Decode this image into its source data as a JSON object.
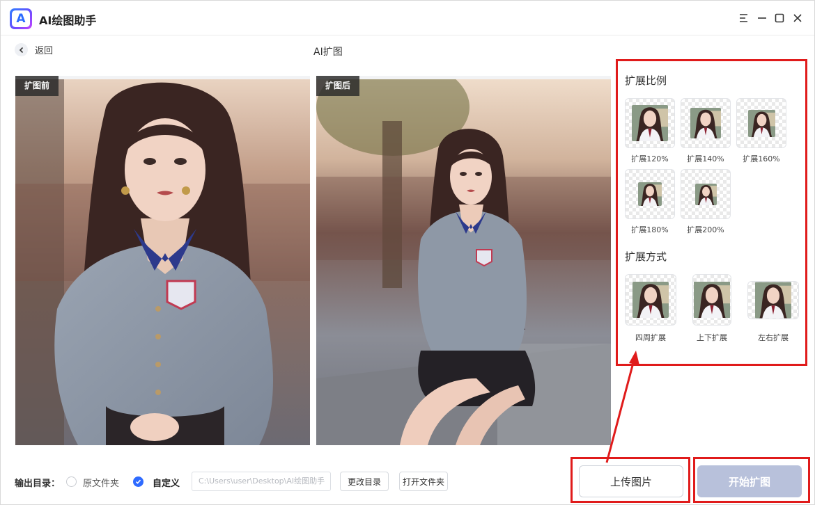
{
  "app": {
    "title": "AI绘图助手",
    "logo_letter": "A"
  },
  "window_controls": [
    "menu-icon",
    "minimize-icon",
    "maximize-icon",
    "close-icon"
  ],
  "nav": {
    "back_label": "返回",
    "page_title": "AI扩图"
  },
  "panels": {
    "before_tag": "扩图前",
    "after_tag": "扩图后"
  },
  "options": {
    "ratio_title": "扩展比例",
    "ratios": [
      {
        "label": "扩展120%",
        "scale": 1.2
      },
      {
        "label": "扩展140%",
        "scale": 1.4
      },
      {
        "label": "扩展160%",
        "scale": 1.6
      },
      {
        "label": "扩展180%",
        "scale": 1.8
      },
      {
        "label": "扩展200%",
        "scale": 2.0
      }
    ],
    "mode_title": "扩展方式",
    "modes": [
      {
        "label": "四周扩展"
      },
      {
        "label": "上下扩展"
      },
      {
        "label": "左右扩展"
      }
    ]
  },
  "output": {
    "label": "输出目录：",
    "radio_original": "原文件夹",
    "radio_custom": "自定义",
    "selected": "自定义",
    "path": "C:\\Users\\user\\Desktop\\AI绘图助手",
    "change_dir": "更改目录",
    "open_folder": "打开文件夹"
  },
  "actions": {
    "upload": "上传图片",
    "start": "开始扩图"
  },
  "colors": {
    "accent": "#2f6bff",
    "annotation_red": "#e01b1b",
    "start_disabled": "#b8c1db"
  }
}
